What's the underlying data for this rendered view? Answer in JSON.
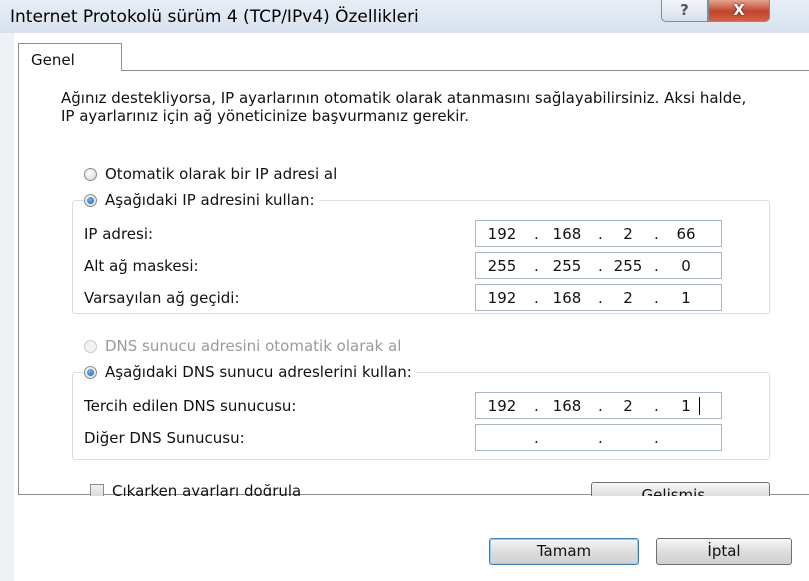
{
  "window": {
    "title": "Internet Protokolü sürüm 4 (TCP/IPv4) Özellikleri",
    "help_label": "?",
    "close_label": "X"
  },
  "tabs": [
    {
      "label": "Genel"
    }
  ],
  "intro_text": "Ağınız destekliyorsa, IP ayarlarının otomatik olarak atanmasını sağlayabilirsiniz. Aksi halde, IP ayarlarınız için ağ yöneticinize başvurmanız gerekir.",
  "ip_section": {
    "auto_label": "Otomatik olarak bir IP adresi al",
    "auto_selected": false,
    "manual_label": "Aşağıdaki IP adresini kullan:",
    "manual_selected": true,
    "fields": [
      {
        "label": "IP adresi:",
        "octets": [
          "192",
          "168",
          "2",
          "66"
        ]
      },
      {
        "label": "Alt ağ maskesi:",
        "octets": [
          "255",
          "255",
          "255",
          "0"
        ]
      },
      {
        "label": "Varsayılan ağ geçidi:",
        "octets": [
          "192",
          "168",
          "2",
          "1"
        ]
      }
    ]
  },
  "dns_section": {
    "auto_label": "DNS sunucu adresini otomatik olarak al",
    "auto_disabled": true,
    "manual_label": "Aşağıdaki DNS sunucu adreslerini kullan:",
    "manual_selected": true,
    "fields": [
      {
        "label": "Tercih edilen DNS sunucusu:",
        "octets": [
          "192",
          "168",
          "2",
          "1"
        ]
      },
      {
        "label": "Diğer DNS Sunucusu:",
        "octets": [
          "",
          "",
          "",
          ""
        ]
      }
    ]
  },
  "validate_checkbox": {
    "label": "Çıkarken ayarları doğrula",
    "checked": false
  },
  "buttons": {
    "advanced": "Gelişmiş...",
    "ok": "Tamam",
    "cancel": "İptal"
  },
  "separator": "."
}
